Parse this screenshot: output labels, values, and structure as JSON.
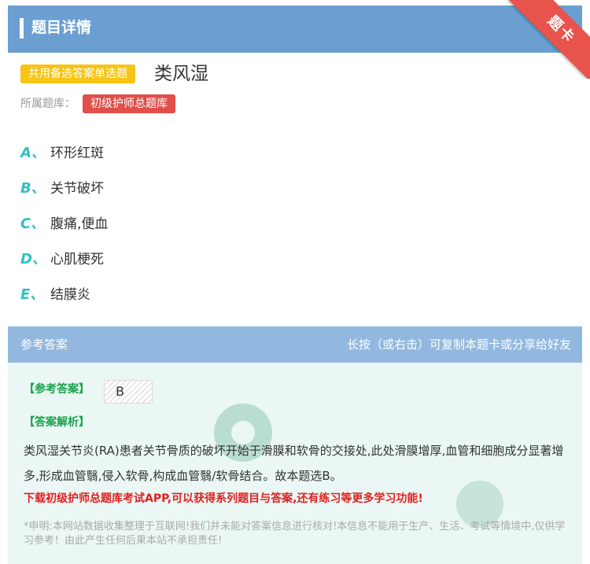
{
  "header": {
    "title": "题目详情"
  },
  "ribbon": {
    "label": "题卡"
  },
  "question": {
    "type_badge": "共用备选答案单选题",
    "title": "类风湿",
    "bank_label": "所属题库：",
    "bank_name": "初级护师总题库"
  },
  "options": [
    {
      "letter": "A、",
      "text": "环形红斑"
    },
    {
      "letter": "B、",
      "text": "关节破坏"
    },
    {
      "letter": "C、",
      "text": "腹痛,便血"
    },
    {
      "letter": "D、",
      "text": "心肌梗死"
    },
    {
      "letter": "E、",
      "text": "结膜炎"
    }
  ],
  "answer_section": {
    "title": "参考答案",
    "hint": "长按（或右击）可复制本题卡或分享给好友",
    "ref_label": "【参考答案】",
    "ref_value": "B",
    "analysis_label": "【答案解析】",
    "analysis_text": "类风湿关节炎(RA)患者关节骨质的破坏开始于滑膜和软骨的交接处,此处滑膜增厚,血管和细胞成分显著增多,形成血管翳,侵入软骨,构成血管翳/软骨结合。故本题选B。",
    "download_text": "下载初级护师总题库考试APP,可以获得系列题目与答案,还有练习等更多学习功能!",
    "disclaimer": "*申明:本网站数据收集整理于互联网!我们并未能对答案信息进行核对!本信息不能用于生产、生活、考试等情境中,仅供学习参考！由此产生任何后果本站不承担责任!"
  }
}
